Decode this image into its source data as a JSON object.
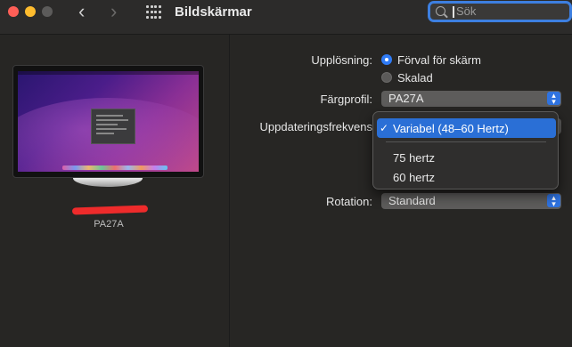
{
  "window": {
    "title": "Bildskärmar",
    "search_placeholder": "Sök"
  },
  "display": {
    "name": "PA27A"
  },
  "form": {
    "resolution_label": "Upplösning:",
    "resolution_options": [
      {
        "label": "Förval för skärm",
        "selected": true
      },
      {
        "label": "Skalad",
        "selected": false
      }
    ],
    "color_profile_label": "Färgprofil:",
    "color_profile_value": "PA27A",
    "refresh_rate_label": "Uppdateringsfrekvens",
    "rotation_label": "Rotation:",
    "rotation_value": "Standard"
  },
  "refresh_menu": {
    "selected": "Variabel (48–60 Hertz)",
    "check_mark": "✓",
    "options": [
      "75 hertz",
      "60 hertz"
    ]
  },
  "colors": {
    "accent": "#2f7bf5",
    "background": "#272624"
  },
  "icons": [
    "back-chevron-icon",
    "forward-chevron-icon",
    "grid-icon",
    "search-icon",
    "popup-chevron-icon",
    "checkmark-icon"
  ]
}
